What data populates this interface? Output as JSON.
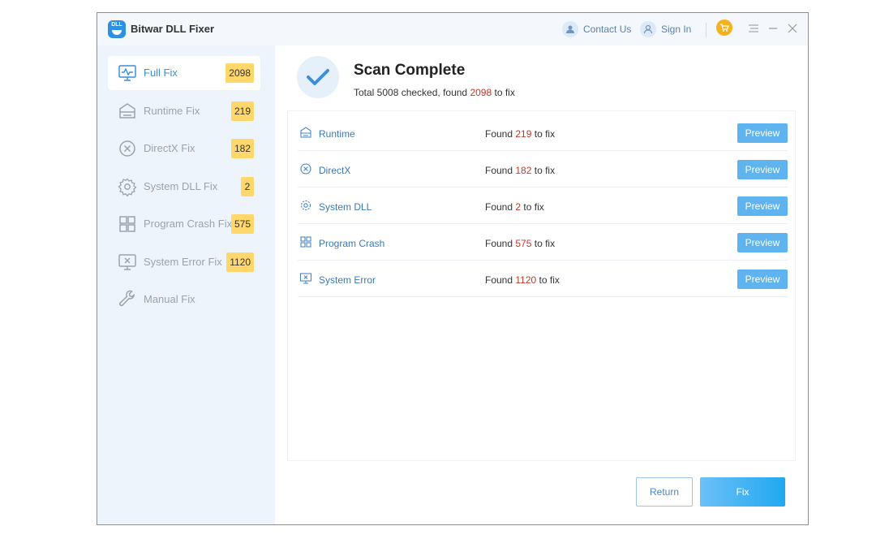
{
  "app": {
    "title": "Bitwar DLL Fixer",
    "logo_text": "DLL"
  },
  "titlebar": {
    "contact": "Contact Us",
    "signin": "Sign In"
  },
  "sidebar": {
    "items": [
      {
        "label": "Full Fix",
        "badge": "2098",
        "icon": "monitor-pulse-icon",
        "active": true
      },
      {
        "label": "Runtime Fix",
        "badge": "219",
        "icon": "layers-icon"
      },
      {
        "label": "DirectX Fix",
        "badge": "182",
        "icon": "x-circle-icon"
      },
      {
        "label": "System DLL Fix",
        "badge": "2",
        "icon": "gear-icon"
      },
      {
        "label": "Program Crash Fix",
        "badge": "575",
        "icon": "grid-icon"
      },
      {
        "label": "System Error Fix",
        "badge": "1120",
        "icon": "monitor-x-icon"
      },
      {
        "label": "Manual Fix",
        "badge": null,
        "icon": "wrench-icon"
      }
    ]
  },
  "scan": {
    "title": "Scan Complete",
    "sub_prefix": "Total 5008 checked, found",
    "found": "2098",
    "sub_suffix": "to fix"
  },
  "results": {
    "rows": [
      {
        "name": "Runtime",
        "count": "219"
      },
      {
        "name": "DirectX",
        "count": "182"
      },
      {
        "name": "System DLL",
        "count": "2"
      },
      {
        "name": "Program Crash",
        "count": "575"
      },
      {
        "name": "System Error",
        "count": "1120"
      }
    ],
    "found_label": "Found",
    "tofix_label": "to fix",
    "preview_label": "Preview"
  },
  "actions": {
    "return_label": "Return",
    "fix_label": "Fix"
  },
  "colors": {
    "accent": "#3a8fd8",
    "badge": "#ffd76a",
    "count_red": "#c0392b",
    "preview": "#5fb3ef"
  }
}
